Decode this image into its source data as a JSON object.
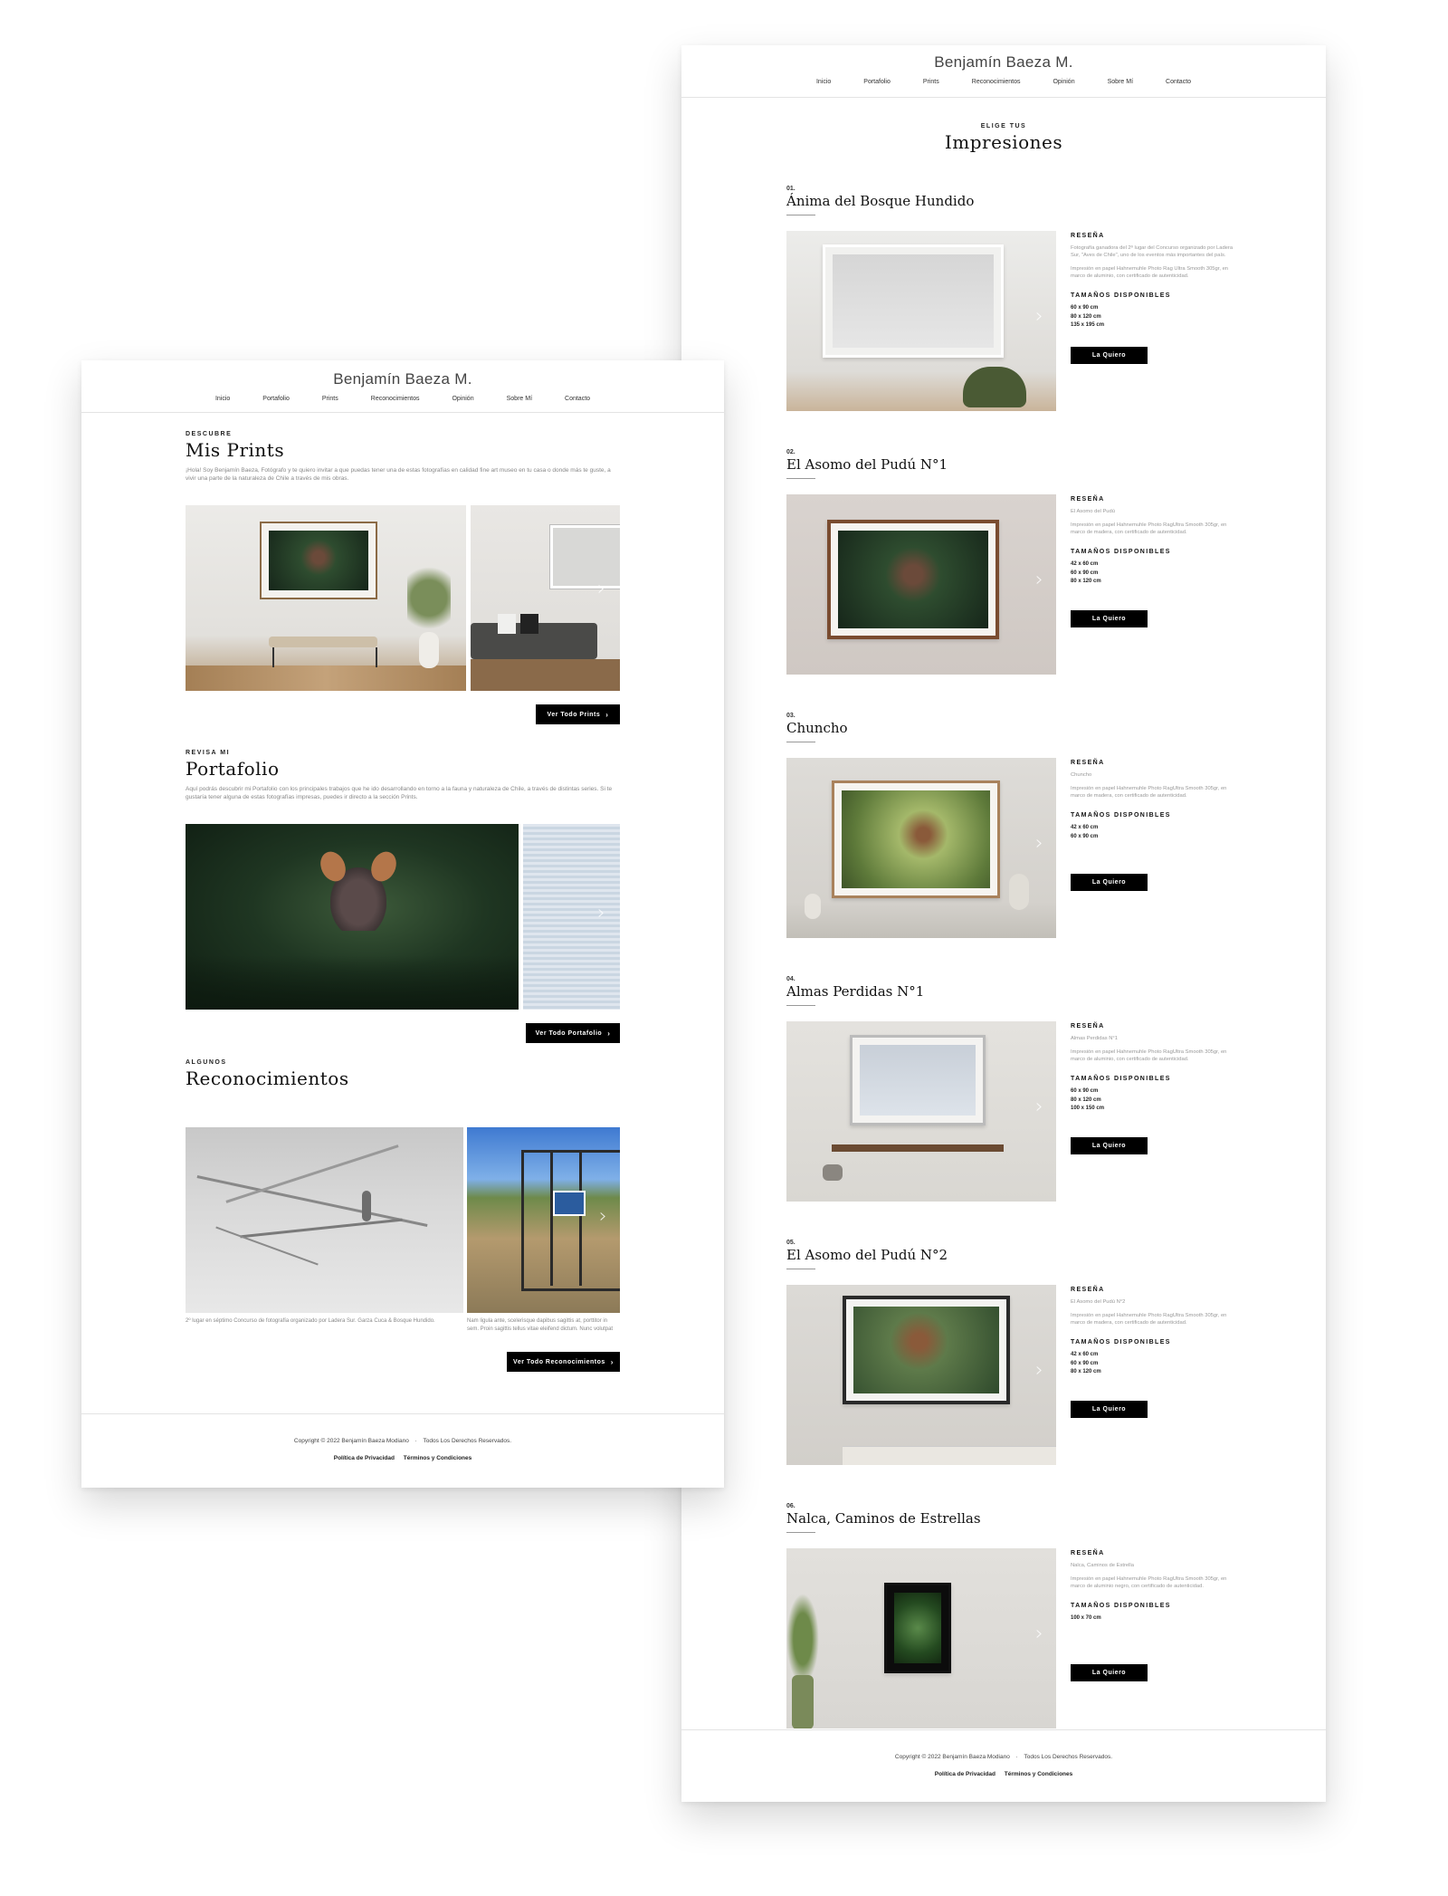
{
  "brand": "Benjamín Baeza M.",
  "nav": [
    "Inicio",
    "Portafolio",
    "Prints",
    "Reconocimientos",
    "Opinión",
    "Sobre Mí",
    "Contacto"
  ],
  "home": {
    "prints": {
      "eyebrow": "DESCUBRE",
      "title": "Mis Prints",
      "intro": "¡Hola! Soy Benjamín Baeza, Fotógrafo y te quiero invitar a que puedas tener una de estas fotografías en calidad fine art museo en tu casa o donde más te guste, a vivir una parte de la naturaleza de Chile a través de mis obras.",
      "button": "Ver Todo Prints"
    },
    "portfolio": {
      "eyebrow": "REVISA MI",
      "title": "Portafolio",
      "intro": "Aquí podrás descubrir mi Portafolio con los principales trabajos que he ido desarrollando en torno a la fauna y naturaleza de Chile, a través de distintas series. Si te gustaría tener alguna de estas fotografías impresas, puedes ir directo a la sección Prints.",
      "button": "Ver Todo Portafolio"
    },
    "awards": {
      "eyebrow": "ALGUNOS",
      "title": "Reconocimientos",
      "captions": [
        "2º lugar en séptimo Concurso de fotografía organizado por Ladera Sur. Garza Cuca & Bosque Hundido.",
        "Nam ligula ante, scelerisque dapibus sagittis at, porttitor in sem. Proin sagittis tellus vitae eleifend dictum. Nunc volutpat"
      ],
      "button": "Ver Todo Reconocimientos"
    }
  },
  "footer": {
    "copyright": "Copyright © 2022 Benjamín Baeza Modiano",
    "separator": "·",
    "rights": "Todos Los Derechos Reservados.",
    "links": [
      "Política de Privacidad",
      "Términos y Condiciones"
    ]
  },
  "prints_page": {
    "eyebrow": "ELIGE TUS",
    "title": "Impresiones",
    "review_heading": "RESEÑA",
    "sizes_heading": "TAMAÑOS DISPONIBLES",
    "button": "La Quiero",
    "items": [
      {
        "num": "01.",
        "title": "Ánima del Bosque Hundido",
        "review": "Fotografía ganadora del 2º lugar del Concurso organizado por Ladera Sur, \"Aves de Chile\", uno de los eventos más importantes del país.",
        "paper": "Impresión en papel Hahnemuhle Photo Rag Ultra Smooth 305gr, en marco de aluminio, con certificado de autenticidad.",
        "sizes": [
          "60 x 90 cm",
          "80 x 120 cm",
          "135 x 195 cm"
        ]
      },
      {
        "num": "02.",
        "title": "El Asomo del Pudú N°1",
        "review": "El Asomo del Pudú",
        "paper": "Impresión en papel Hahnemuhle Photo RagUltra Smooth 305gr, en marco de madera, con certificado de autenticidad.",
        "sizes": [
          "42 x 60 cm",
          "60 x 90 cm",
          "80 x 120 cm"
        ]
      },
      {
        "num": "03.",
        "title": "Chuncho",
        "review": "Chuncho",
        "paper": "Impresión en papel Hahnemuhle Photo RagUltra Smooth 305gr, en marco de madera, con certificado de autenticidad.",
        "sizes": [
          "42 x 60 cm",
          "60 x 90 cm"
        ]
      },
      {
        "num": "04.",
        "title": "Almas Perdidas N°1",
        "review": "Almas Perdidas N°1",
        "paper": "Impresión en papel Hahnemuhle Photo RagUltra Smooth 305gr, en marco de aluminio, con certificado de autenticidad.",
        "sizes": [
          "60 x 90 cm",
          "80 x 120 cm",
          "100 x 150 cm"
        ]
      },
      {
        "num": "05.",
        "title": "El Asomo del Pudú N°2",
        "review": "El Asomo del Pudú N°2",
        "paper": "Impresión en papel Hahnemuhle Photo RagUltra Smooth 305gr, en marco de madera, con certificado de autenticidad.",
        "sizes": [
          "42 x 60 cm",
          "60 x 90 cm",
          "80 x 120 cm"
        ]
      },
      {
        "num": "06.",
        "title": "Nalca, Caminos de Estrellas",
        "review": "Nalca, Caminos de Estrella",
        "paper": "Impresión en papel Hahnemuhle Photo RagUltra Smooth 305gr, en marco de aluminio negro, con certificado de autenticidad.",
        "sizes": [
          "100 x 70 cm"
        ]
      }
    ]
  }
}
